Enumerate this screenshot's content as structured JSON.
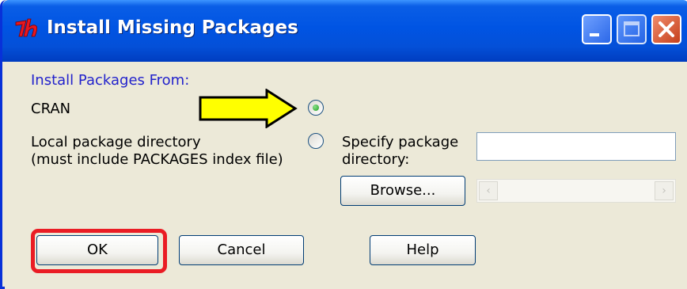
{
  "window": {
    "title": "Install Missing Packages"
  },
  "form": {
    "section_label": "Install Packages From:",
    "options": [
      {
        "label": "CRAN",
        "selected": true
      },
      {
        "label_line1": "Local package directory",
        "label_line2": "(must include PACKAGES index file)",
        "selected": false
      }
    ],
    "directory_label_line1": "Specify package",
    "directory_label_line2": "directory:",
    "directory_value": "",
    "browse_label": "Browse..."
  },
  "buttons": {
    "ok": "OK",
    "cancel": "Cancel",
    "help": "Help"
  },
  "colors": {
    "titlebar": "#0054e3",
    "section_label": "#2222cc",
    "highlight": "#ea1c24",
    "arrow_fill": "#ffff00"
  },
  "icons": {
    "app": "tk-feather-icon",
    "minimize": "minimize-icon",
    "maximize": "maximize-icon",
    "close": "close-icon",
    "callout": "yellow-arrow-icon"
  }
}
